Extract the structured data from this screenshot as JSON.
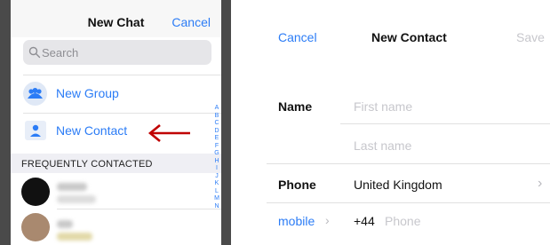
{
  "new_chat": {
    "title": "New Chat",
    "cancel_label": "Cancel",
    "search_placeholder": "Search",
    "new_group_label": "New Group",
    "new_contact_label": "New Contact",
    "section_title": "FREQUENTLY CONTACTED",
    "index_letters": [
      "A",
      "B",
      "C",
      "D",
      "E",
      "F",
      "G",
      "H",
      "I",
      "J",
      "K",
      "L",
      "M",
      "N"
    ]
  },
  "new_contact": {
    "cancel_label": "Cancel",
    "title": "New Contact",
    "save_label": "Save",
    "name_label": "Name",
    "first_name_placeholder": "First name",
    "last_name_placeholder": "Last name",
    "phone_label": "Phone",
    "country": "United Kingdom",
    "phone_type": "mobile",
    "country_code": "+44",
    "phone_placeholder": "Phone"
  },
  "colors": {
    "accent": "#2b7cf6",
    "annotation_arrow": "#c00000"
  }
}
